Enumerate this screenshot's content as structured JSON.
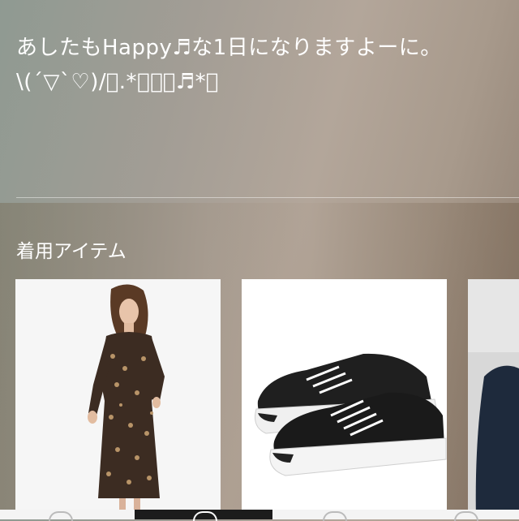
{
  "comment": {
    "line1": "あしたもHappy♬な1日になりますよーに。",
    "line2": "\\(´▽`♡)/ﾟ.*･｡ﾟ♬*ﾟ"
  },
  "section": {
    "title": "着用アイテム"
  },
  "items": [
    {
      "name": "item-dress"
    },
    {
      "name": "item-sneakers"
    },
    {
      "name": "item-partial"
    }
  ],
  "colors": {
    "tag": "#2f88d0",
    "tab_active": "#1c1c1c"
  }
}
